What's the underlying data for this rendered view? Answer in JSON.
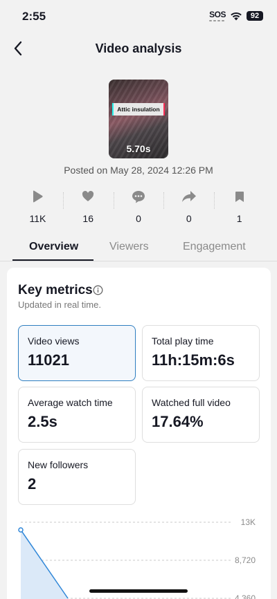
{
  "status_bar": {
    "time": "2:55",
    "sos": "SOS",
    "battery": "92"
  },
  "nav": {
    "back_icon": "chevron-left-icon",
    "title": "Video analysis"
  },
  "video": {
    "caption": "Attic insulation",
    "duration": "5.70s",
    "posted": "Posted on May 28, 2024 12:26 PM"
  },
  "stats": [
    {
      "icon": "play-icon",
      "value": "11K"
    },
    {
      "icon": "heart-icon",
      "value": "16"
    },
    {
      "icon": "comment-icon",
      "value": "0"
    },
    {
      "icon": "share-icon",
      "value": "0"
    },
    {
      "icon": "bookmark-icon",
      "value": "1"
    }
  ],
  "tabs": {
    "overview": "Overview",
    "viewers": "Viewers",
    "engagement": "Engagement",
    "active": "Overview"
  },
  "key_metrics": {
    "title": "Key metrics",
    "subtitle": "Updated in real time.",
    "video_views": {
      "label": "Video views",
      "value": "11021"
    },
    "total_play_time": {
      "label": "Total play time",
      "value": "11h:15m:6s"
    },
    "average_watch_time": {
      "label": "Average watch time",
      "value": "2.5s"
    },
    "watched_full_video": {
      "label": "Watched full video",
      "value": "17.64%"
    },
    "new_followers": {
      "label": "New followers",
      "value": "2"
    }
  },
  "colors": {
    "accent": "#2e7ec0",
    "chart_line": "#2e86d8",
    "chart_fill": "#dbe9f8"
  },
  "chart_data": {
    "type": "area",
    "y_ticks": [
      "13K",
      "8,720",
      "4,360"
    ],
    "ylim": [
      4360,
      13080
    ],
    "series": [
      {
        "values": [
          12200,
          4360
        ]
      }
    ],
    "grid": true
  }
}
